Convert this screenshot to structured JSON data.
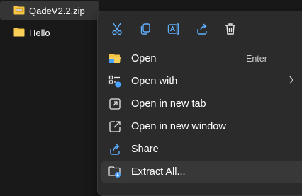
{
  "files": [
    {
      "name": "QadeV2.2.zip",
      "icon": "zip-folder-icon"
    },
    {
      "name": "Hello",
      "icon": "folder-icon"
    }
  ],
  "menu": {
    "toolbar": [
      {
        "name": "cut",
        "icon": "scissors-icon"
      },
      {
        "name": "copy",
        "icon": "copy-icon"
      },
      {
        "name": "rename",
        "icon": "rename-icon"
      },
      {
        "name": "share",
        "icon": "share-icon"
      },
      {
        "name": "delete",
        "icon": "trash-icon"
      }
    ],
    "items": [
      {
        "label": "Open",
        "shortcut": "Enter",
        "icon": "open-folder-icon"
      },
      {
        "label": "Open with",
        "icon": "open-with-icon",
        "submenu": true
      },
      {
        "label": "Open in new tab",
        "icon": "new-tab-icon"
      },
      {
        "label": "Open in new window",
        "icon": "new-window-icon"
      },
      {
        "label": "Share",
        "icon": "share-icon"
      },
      {
        "label": "Extract All...",
        "icon": "extract-icon",
        "highlighted": true
      }
    ]
  },
  "colors": {
    "accent": "#4aa3ff",
    "folder": "#f5c443",
    "menu_bg": "#2b2b2b",
    "hover": "#383838"
  }
}
